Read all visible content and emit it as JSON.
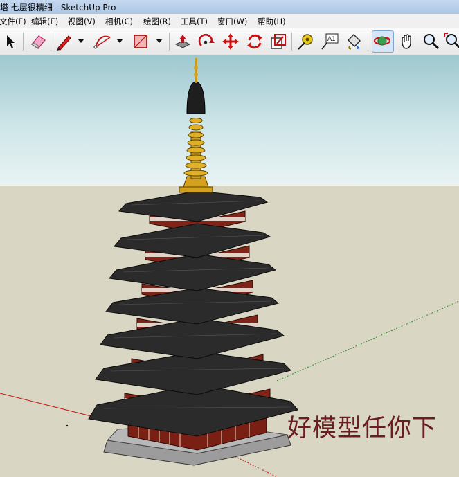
{
  "window": {
    "title": "塔 七层很精细 - SketchUp Pro"
  },
  "menu": {
    "items": [
      {
        "label": "文件(F)"
      },
      {
        "label": "编辑(E)"
      },
      {
        "label": "视图(V)"
      },
      {
        "label": "相机(C)"
      },
      {
        "label": "绘图(R)"
      },
      {
        "label": "工具(T)"
      },
      {
        "label": "窗口(W)"
      },
      {
        "label": "帮助(H)"
      }
    ]
  },
  "toolbar": {
    "tools": [
      {
        "icon": "select-arrow-icon"
      },
      {
        "icon": "eraser-icon"
      },
      {
        "icon": "pencil-line-icon"
      },
      {
        "icon": "arc-icon"
      },
      {
        "icon": "rectangle-icon"
      },
      {
        "icon": "push-pull-icon"
      },
      {
        "icon": "follow-me-icon"
      },
      {
        "icon": "move-icon"
      },
      {
        "icon": "rotate-icon"
      },
      {
        "icon": "scale-icon"
      },
      {
        "icon": "tape-measure-icon"
      },
      {
        "icon": "text-label-icon"
      },
      {
        "icon": "paint-bucket-icon"
      },
      {
        "icon": "orbit-icon"
      },
      {
        "icon": "pan-hand-icon"
      },
      {
        "icon": "zoom-icon"
      },
      {
        "icon": "zoom-extents-icon"
      }
    ],
    "text_tool_glyph": "A1",
    "active_tool": "orbit-icon"
  },
  "viewport": {
    "colors": {
      "sky": "#b8dadd",
      "ground": "#d9d6c3",
      "roof": "#2b2b2b",
      "pillar": "#7a1f14",
      "gold": "#d4a020"
    }
  },
  "watermark": {
    "text": "好模型任你下"
  }
}
